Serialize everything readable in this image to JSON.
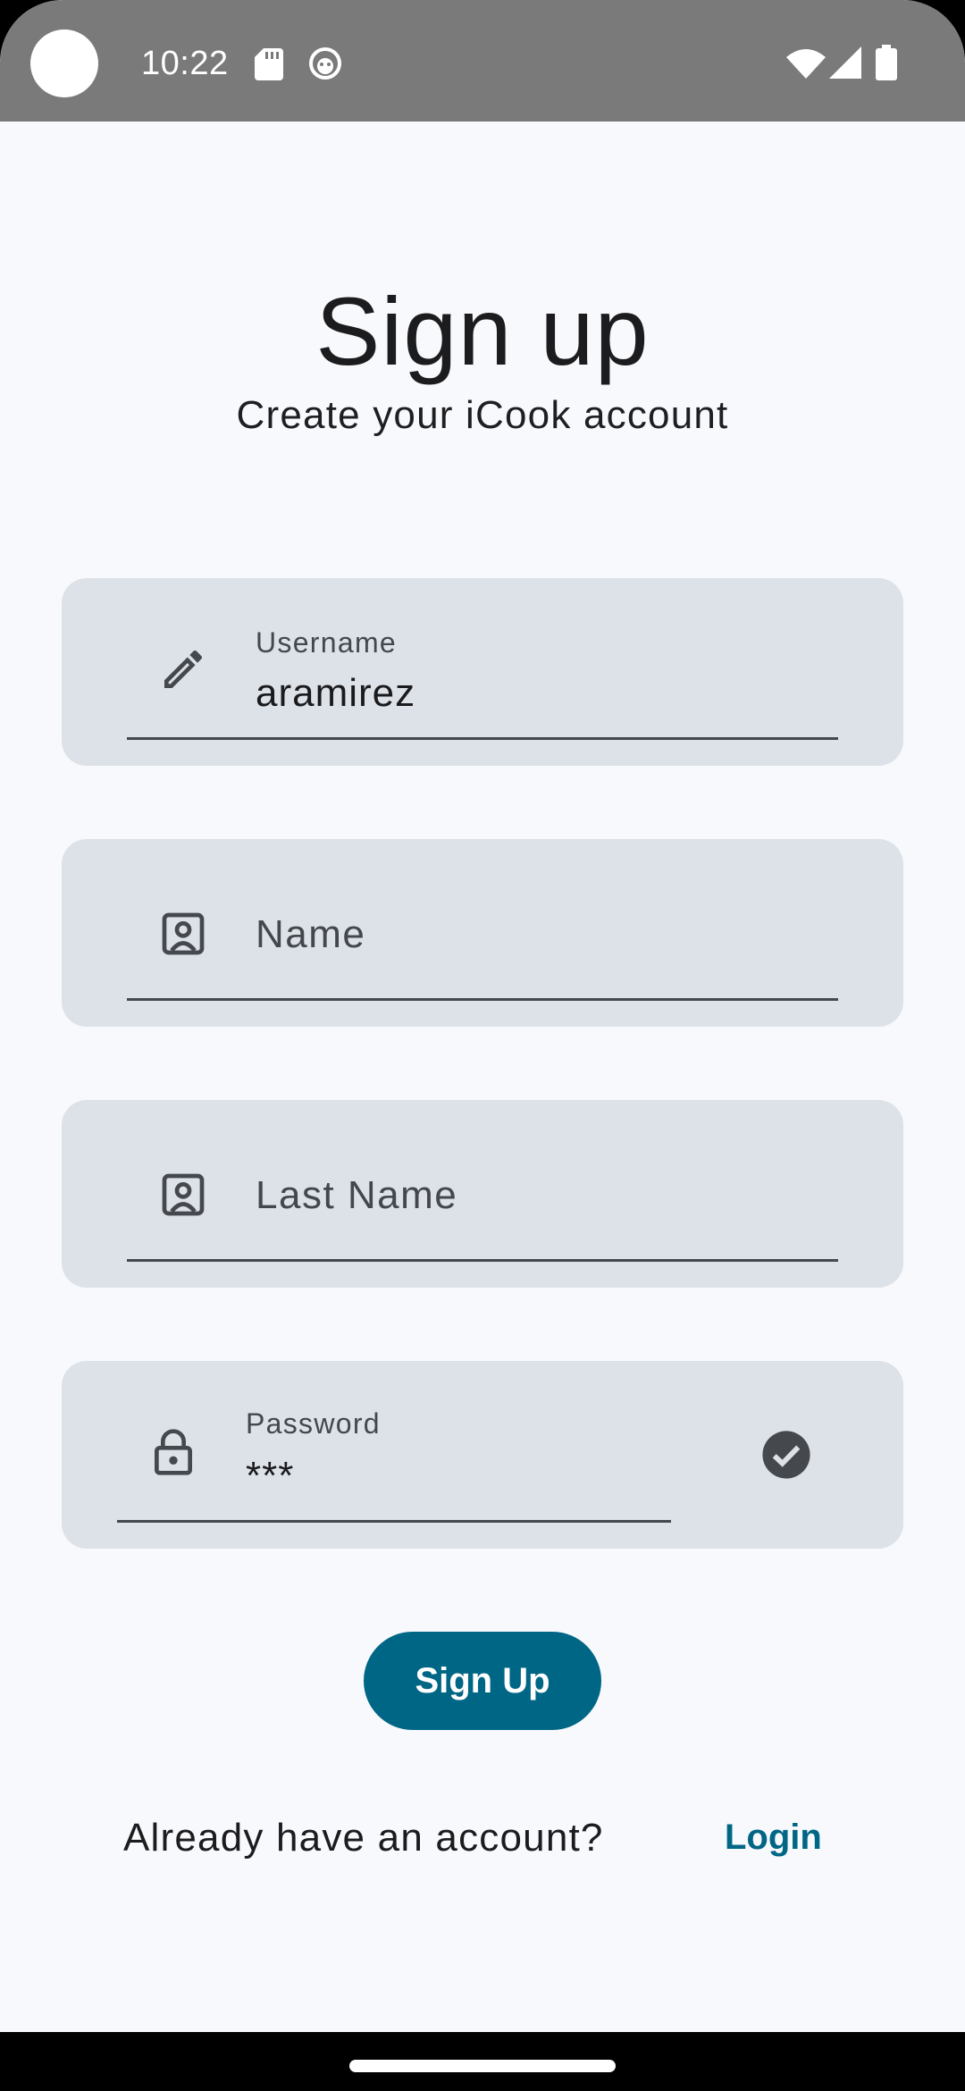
{
  "status_bar": {
    "time": "10:22",
    "icons": [
      "sd-card-icon",
      "face-icon",
      "wifi-icon",
      "signal-icon",
      "battery-icon"
    ]
  },
  "header": {
    "title": "Sign up",
    "subtitle": "Create your iCook account"
  },
  "form": {
    "username": {
      "label": "Username",
      "value": "aramirez",
      "icon": "pencil-icon"
    },
    "name": {
      "placeholder": "Name",
      "icon": "contact-portrait-icon"
    },
    "last_name": {
      "placeholder": "Last Name",
      "icon": "contact-portrait-icon"
    },
    "password": {
      "label": "Password",
      "value": "***",
      "icon": "lock-icon",
      "trailing_icon": "check-circle-icon"
    }
  },
  "actions": {
    "signup_label": "Sign Up",
    "already_text": "Already have an account?",
    "login_label": "Login"
  },
  "colors": {
    "primary": "#006685",
    "field_background": "#dce2e8",
    "page_background": "#f8f9fc",
    "status_bar": "#7a7a7a"
  }
}
